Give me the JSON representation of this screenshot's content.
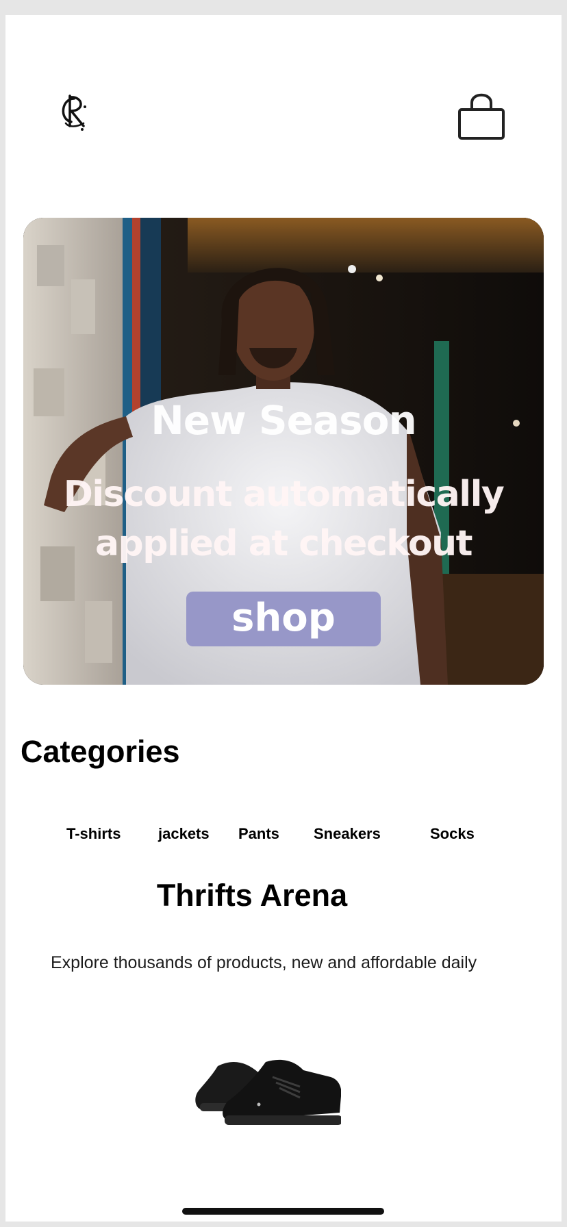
{
  "header": {
    "logo_icon": "rc-monogram-logo",
    "cart_icon": "shopping-bag-icon"
  },
  "hero": {
    "title": "New Season",
    "subtitle_line1": "Discount automatically",
    "subtitle_line2": "applied at checkout",
    "cta_label": "shop",
    "cta_color": "#9797c8"
  },
  "categories": {
    "title": "Categories",
    "items": [
      {
        "label": "T-shirts"
      },
      {
        "label": "jackets"
      },
      {
        "label": "Pants"
      },
      {
        "label": "Sneakers"
      },
      {
        "label": "Socks"
      }
    ]
  },
  "arena": {
    "title": "Thrifts Arena",
    "description": "Explore thousands of products, new and affordable daily",
    "product_icon": "black-sneakers-image"
  }
}
